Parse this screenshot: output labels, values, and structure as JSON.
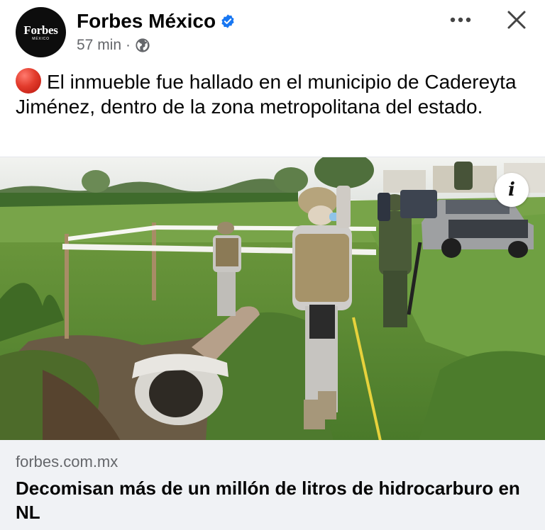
{
  "post": {
    "page_name": "Forbes México",
    "verified_icon": "verified-badge-icon",
    "avatar": {
      "brand": "Forbes",
      "sub": "MÉXICO"
    },
    "time_ago": "57 min",
    "separator": "·",
    "privacy_icon": "globe-icon",
    "text": "El inmueble fue hallado en el municipio de Cadereyta Jiménez, dentro de la zona metropolitana del estado.",
    "emoji_icon": "red-circle-icon",
    "info_label": "i"
  },
  "link_preview": {
    "domain": "forbes.com.mx",
    "title": "Decomisan más de un millón de litros de hidrocarburo en NL"
  },
  "colors": {
    "verified": "#1877f2",
    "secondary_text": "#65676b",
    "card_bg": "#f0f2f5"
  }
}
